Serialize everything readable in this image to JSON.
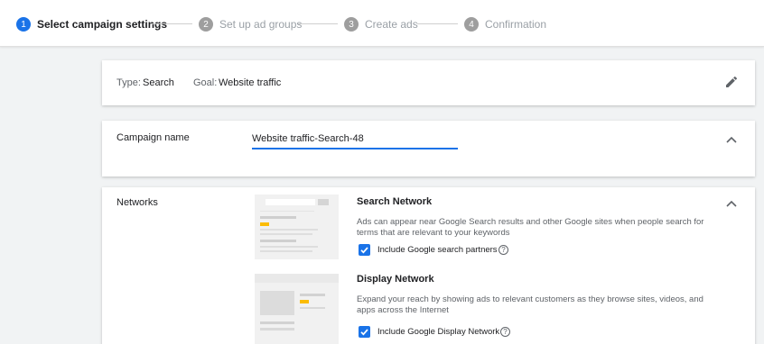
{
  "stepper": {
    "steps": [
      {
        "number": "1",
        "label": "Select campaign settings",
        "state": "active"
      },
      {
        "number": "2",
        "label": "Set up ad groups",
        "state": "inactive"
      },
      {
        "number": "3",
        "label": "Create ads",
        "state": "inactive"
      },
      {
        "number": "4",
        "label": "Confirmation",
        "state": "inactive"
      }
    ]
  },
  "summary": {
    "type_label": "Type:",
    "type_value": "Search",
    "goal_label": "Goal:",
    "goal_value": "Website traffic",
    "edit_icon": "pencil-icon"
  },
  "campaign_name": {
    "label": "Campaign name",
    "value": "Website traffic-Search-48",
    "collapse_icon": "chevron-up-icon"
  },
  "networks": {
    "label": "Networks",
    "collapse_icon": "chevron-up-icon",
    "search": {
      "title": "Search Network",
      "description": "Ads can appear near Google Search results and other Google sites when people search for terms that are relevant to your keywords",
      "checkbox_label": "Include Google search partners",
      "checked": true
    },
    "display": {
      "title": "Display Network",
      "description": "Expand your reach by showing ads to relevant customers as they browse sites, videos, and apps across the Internet",
      "checkbox_label": "Include Google Display Network",
      "checked": true
    }
  },
  "colors": {
    "accent": "#1a73e8",
    "ad_highlight": "#fbbc04",
    "background": "#f1f3f4"
  }
}
